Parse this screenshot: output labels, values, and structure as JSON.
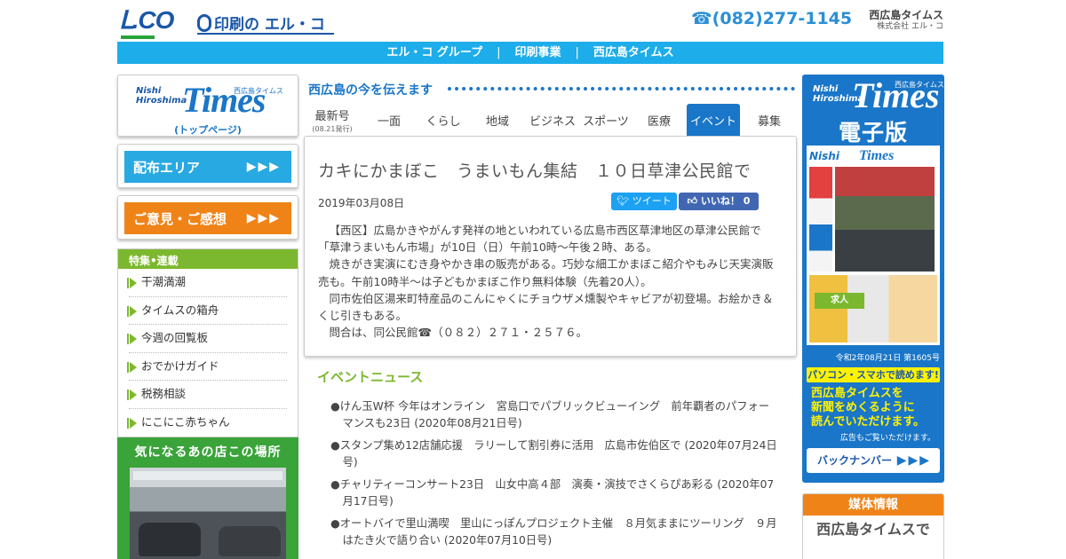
{
  "header": {
    "logo_lco": "Ⅼ.CO",
    "logo_print": "印刷の エル・コ",
    "phone": "☎(082)277-1145",
    "company_name": "西広島タイムス",
    "company_sub": "株式会社 エル・コ"
  },
  "nav": [
    "エル・コ グループ",
    "印刷事業",
    "西広島タイムス"
  ],
  "left": {
    "times_logo": {
      "nishi": "Nishi",
      "hiroshima": "Hiroshima",
      "times": "Times",
      "small": "西広島タイムス",
      "top": "(トップページ)"
    },
    "buttons": [
      {
        "label": "配布エリア",
        "arrows": "▶▶▶",
        "color": "#29a9e1"
      },
      {
        "label": "ご意見・ご感想",
        "arrows": "▶▶▶",
        "color": "#ef8317"
      }
    ],
    "feature_title": "特集•連載",
    "feature_items": [
      "干潮満潮",
      "タイムスの箱舟",
      "今週の回覧板",
      "おでかけガイド",
      "税務相談",
      "にこにこ赤ちゃん"
    ],
    "shop_title": "気になるあの店この場所"
  },
  "center": {
    "tagline": "西広島の今を伝えます",
    "tabs": [
      {
        "label": "最新号",
        "sub": "(08.21発行)"
      },
      {
        "label": "一面"
      },
      {
        "label": "くらし"
      },
      {
        "label": "地域"
      },
      {
        "label": "ビジネス"
      },
      {
        "label": "スポーツ"
      },
      {
        "label": "医療"
      },
      {
        "label": "イベント",
        "active": true
      },
      {
        "label": "募集"
      }
    ],
    "article": {
      "title": "カキにかまぼこ　うまいもん集結　１０日草津公民館で",
      "date": "2019年03月08日",
      "tweet": "ツイート",
      "like": "いいね！ 0",
      "paragraphs": [
        "【西区】広島かきやがんす発祥の地といわれている広島市西区草津地区の草津公民館で「草津うまいもん市場」が10日（日）午前10時〜午後２時、ある。",
        "焼きがき実演にむき身やかき串の販売がある。巧妙な細工かまぼこ紹介やもみじ天実演販売も。午前10時半〜は子どもかまぼこ作り無料体験（先着20人）。",
        "同市佐伯区湯来町特産品のこんにゃくにチョウザメ燻製やキャビアが初登場。お絵かき＆くじ引きもある。",
        "問合は、同公民館☎（０８２）２７１・２５７６。"
      ]
    },
    "news": {
      "title": "イベントニュース",
      "items": [
        "●けん玉W杯 今年はオンライン　宮島口でパブリックビューイング　前年覇者のパフォーマンスも23日 (2020年08月21日号)",
        "●スタンプ集め12店舗応援　ラリーして割引券に活用　広島市佐伯区で (2020年07月24日号)",
        "●チャリティーコンサート23日　山女中高４部　演奏・演技でさくらぴあ彩る (2020年07月17日号)",
        "●オートバイで里山満喫　里山にっぽんプロジェクト主催　８月気ままにツーリング　９月はたき火で語り合い (2020年07月10日号)"
      ]
    }
  },
  "right": {
    "edition": {
      "nishi": "Nishi",
      "hiroshima": "Hiroshima",
      "times": "Times",
      "small": "西広島タイムス",
      "title": "電子版",
      "paper_green": "求人",
      "issue": "令和2年08月21日 第1605号",
      "read": "パソコン・スマホで読めます!",
      "desc_lines": [
        "西広島タイムスを",
        "新聞をめくるように",
        "読んでいただけます。"
      ],
      "ad_note": "広告もご覧いただけます。",
      "back": "バックナンバー",
      "back_arrows": "▶▶▶"
    },
    "media": {
      "title": "媒体情報",
      "body": "西広島タイムスで"
    }
  },
  "colors": {
    "accent_blue": "#1a76c8",
    "nav_cyan": "#1dadea",
    "green": "#7cb82f",
    "orange": "#ef8317"
  }
}
